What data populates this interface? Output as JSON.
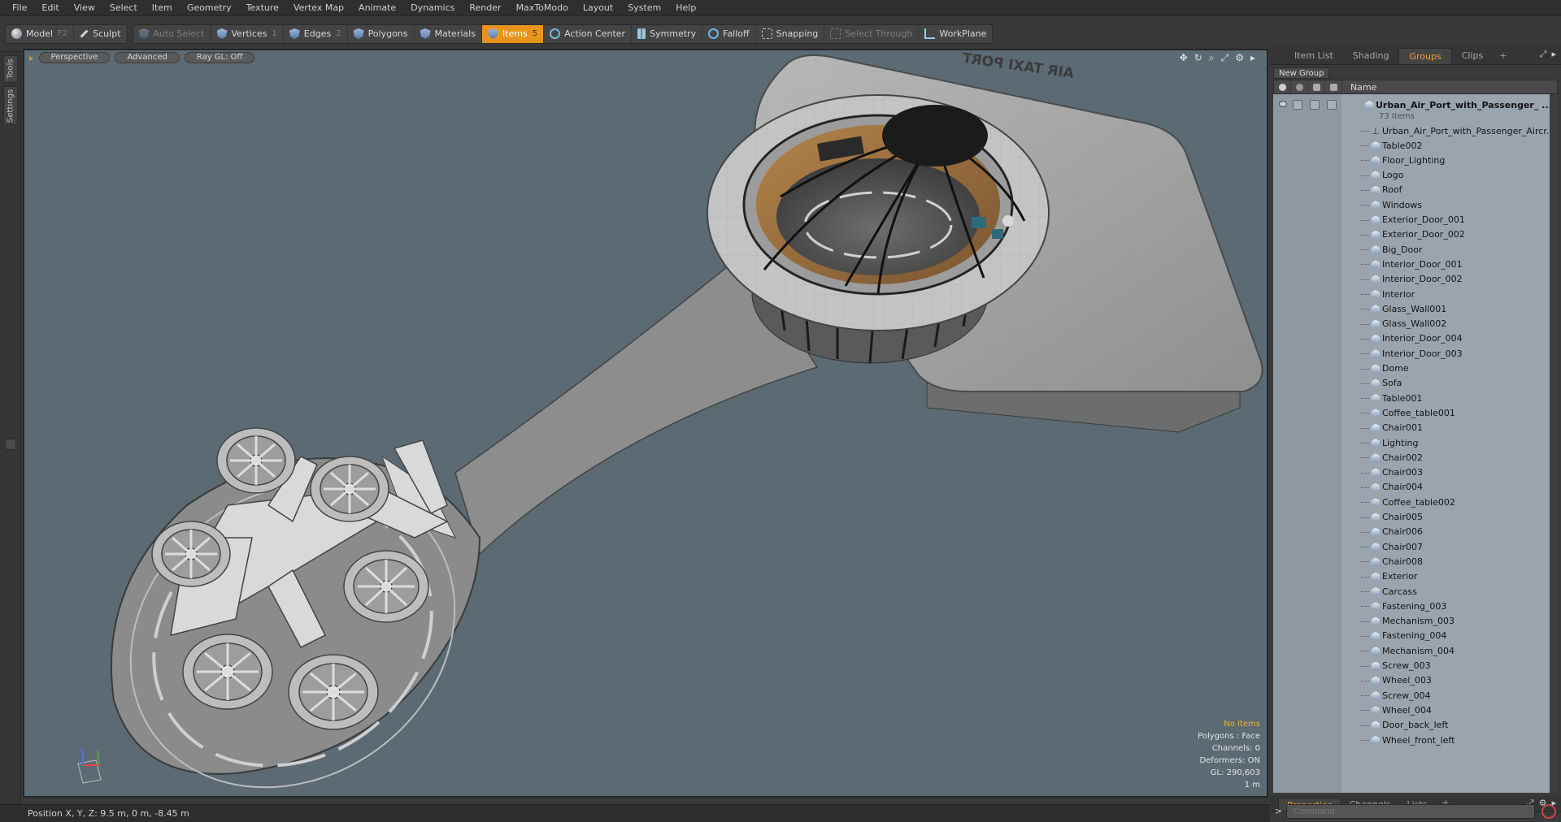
{
  "menu": [
    "File",
    "Edit",
    "View",
    "Select",
    "Item",
    "Geometry",
    "Texture",
    "Vertex Map",
    "Animate",
    "Dynamics",
    "Render",
    "MaxToModo",
    "Layout",
    "System",
    "Help"
  ],
  "toolbar": {
    "model": "Model",
    "model_key": "F2",
    "sculpt": "Sculpt",
    "auto_select": "Auto Select",
    "vertices": "Vertices",
    "vertices_key": "1",
    "edges": "Edges",
    "edges_key": "2",
    "polygons": "Polygons",
    "materials": "Materials",
    "items": "Items",
    "items_key": "5",
    "action_center": "Action Center",
    "symmetry": "Symmetry",
    "falloff": "Falloff",
    "snapping": "Snapping",
    "select_through": "Select Through",
    "workplane": "WorkPlane"
  },
  "left_tabs": {
    "tools": "Tools",
    "settings": "Settings"
  },
  "viewport": {
    "view": "Perspective",
    "advanced": "Advanced",
    "raygl": "Ray GL: Off",
    "sign_text": "AIR TAXI PORT",
    "info": {
      "no_items": "No Items",
      "polygons": "Polygons : Face",
      "channels": "Channels: 0",
      "deformers": "Deformers: ON",
      "gl": "GL: 290,603",
      "scale": "1 m"
    }
  },
  "status": {
    "position": "Position X, Y, Z:  9.5 m, 0 m, -8.45 m"
  },
  "panel": {
    "tabs": [
      "Item List",
      "Shading",
      "Groups",
      "Clips"
    ],
    "active_tab": "Groups",
    "new_group": "New Group",
    "name_col": "Name",
    "group_name": "Urban_Air_Port_with_Passenger_ ...",
    "group_count": "73 Items",
    "first_item": "Urban_Air_Port_with_Passenger_Aircr...",
    "items": [
      "Table002",
      "Floor_Lighting",
      "Logo",
      "Roof",
      "Windows",
      "Exterior_Door_001",
      "Exterior_Door_002",
      "Big_Door",
      "Interior_Door_001",
      "Interior_Door_002",
      "Interior",
      "Glass_Wall001",
      "Glass_Wall002",
      "Interior_Door_004",
      "Interior_Door_003",
      "Dome",
      "Sofa",
      "Table001",
      "Coffee_table001",
      "Chair001",
      "Lighting",
      "Chair002",
      "Chair003",
      "Chair004",
      "Coffee_table002",
      "Chair005",
      "Chair006",
      "Chair007",
      "Chair008",
      "Exterior",
      "Carcass",
      "Fastening_003",
      "Mechanism_003",
      "Fastening_004",
      "Mechanism_004",
      "Screw_003",
      "Wheel_003",
      "Screw_004",
      "Wheel_004",
      "Door_back_left",
      "Wheel_front_left"
    ]
  },
  "props": {
    "tabs": [
      "Properties",
      "Channels",
      "Lists"
    ],
    "active": "Properties"
  },
  "command": {
    "placeholder": "Command"
  }
}
